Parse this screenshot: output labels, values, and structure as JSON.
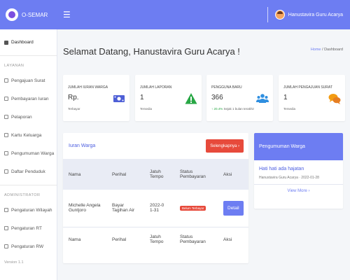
{
  "app": {
    "brand": "O-SEMAR",
    "menu_icon": "☰"
  },
  "user": {
    "name": "Hanustavira Guru Acarya"
  },
  "sidebar": {
    "dashboard": "Dashboard",
    "section_layanan": "LAYANAN",
    "layanan_items": [
      "Pengajuan Surat",
      "Pembayaran Iuran",
      "Pelaporan",
      "Kartu Keluarga",
      "Pengumuman Warga",
      "Daftar Penduduk"
    ],
    "section_admin": "ADMINISTRATOR",
    "admin_items": [
      "Pengaturan Wilayah",
      "Pengaturan RT",
      "Pengaturan RW"
    ],
    "version": "Version 1.1"
  },
  "header": {
    "title": "Selamat Datang, Hanustavira Guru Acarya !",
    "breadcrumb_home": "Home",
    "breadcrumb_sep": "/",
    "breadcrumb_current": "Dashboard"
  },
  "cards": [
    {
      "label": "JUMLAH IURAN WARGA",
      "value": "Rp.",
      "sub": "Terbayar",
      "icon": "money-icon",
      "color": "#4e5fd6"
    },
    {
      "label": "JUMLAH LAPORAN",
      "value": "1",
      "sub": "Tersedia",
      "icon": "warning-icon",
      "color": "#28a745"
    },
    {
      "label": "PENGGUNA BARU",
      "value": "366",
      "sub_up": "↑ 20.4%",
      "sub": "Sejak 1 bulan terakhir",
      "icon": "users-icon",
      "color": "#2f8fe0"
    },
    {
      "label": "JUMLAH PENGAJUAN SURAT",
      "value": "1",
      "sub": "Tersedia",
      "icon": "comments-icon",
      "color": "#f39c12"
    }
  ],
  "iuran": {
    "title": "Iuran Warga",
    "button": "Selengkapnya",
    "headers": [
      "Nama",
      "Perihal",
      "Jatuh Tempo",
      "Status Pembayaran",
      "Aksi"
    ],
    "rows": [
      {
        "nama": "Michelle Angela Guntjoro",
        "perihal": "Bayar Tagihan Air",
        "jatuh_tempo": "2022-01-31",
        "status": "Belum Terbayar",
        "aksi": "Detail"
      }
    ]
  },
  "pengumuman": {
    "title": "Pengumuman Warga",
    "item_title": "Hati hati ada hajatan",
    "item_meta": "Hanustavira Guru Acarya · 2022-01-28",
    "more": "View More"
  }
}
